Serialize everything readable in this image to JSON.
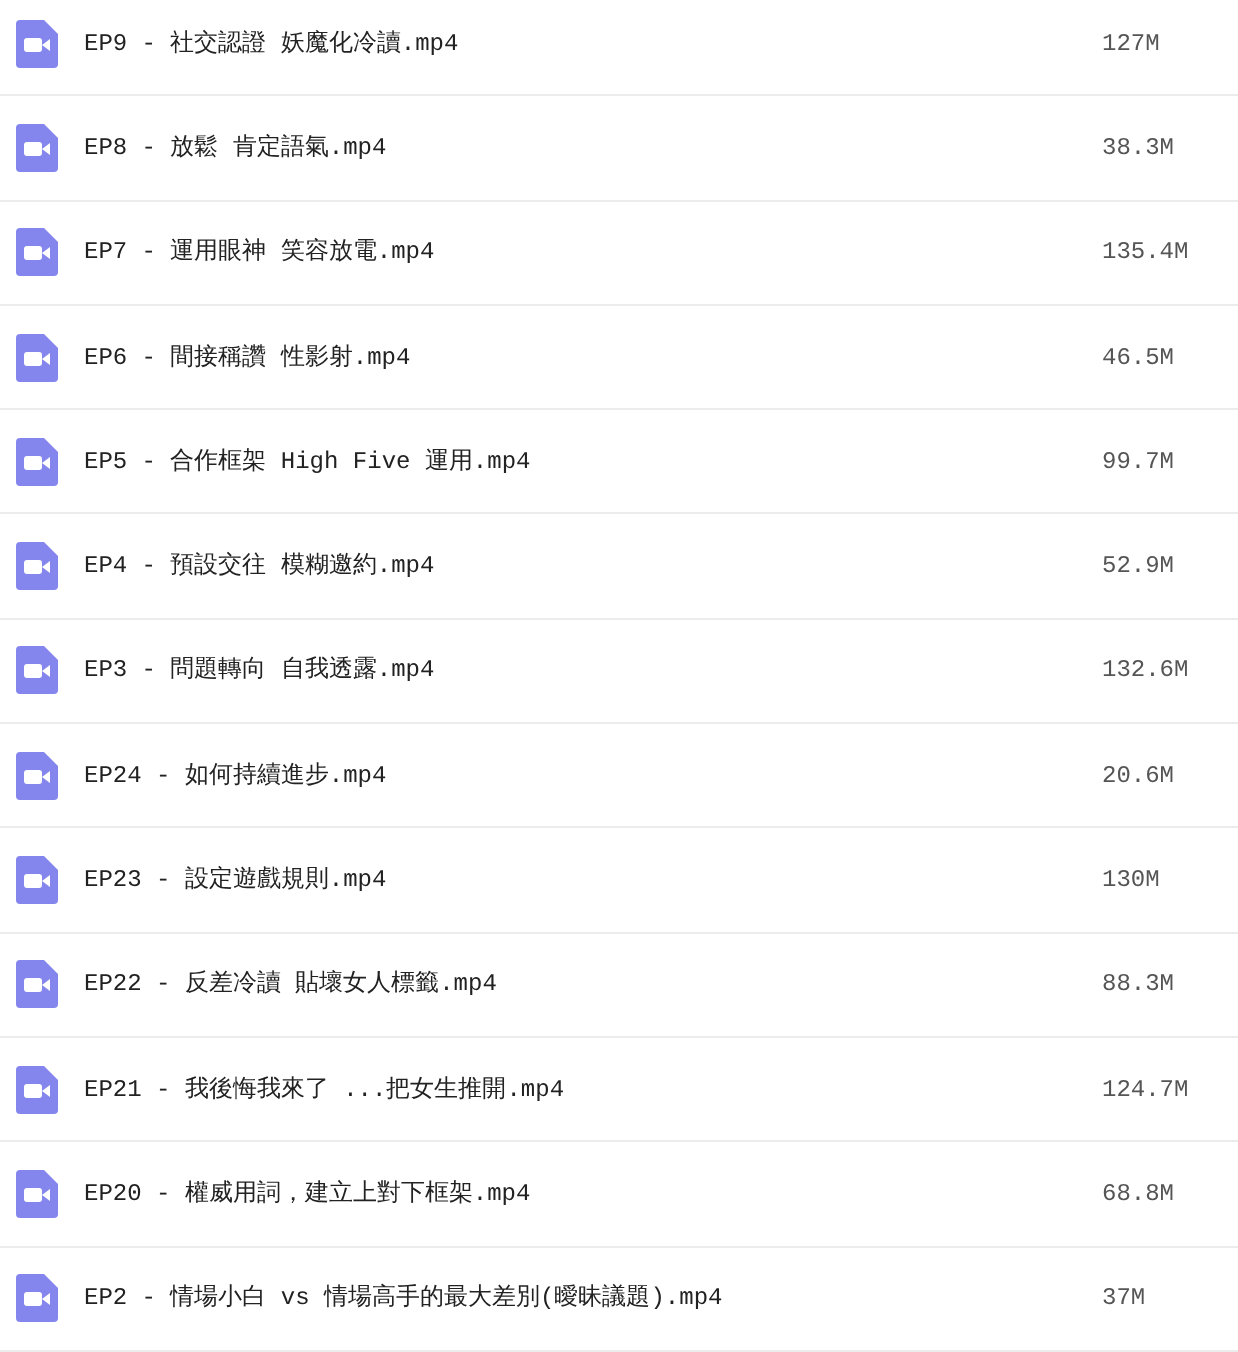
{
  "files": [
    {
      "name": "EP9 - 社交認證 妖魔化冷讀.mp4",
      "size": "127M"
    },
    {
      "name": "EP8 - 放鬆 肯定語氣.mp4",
      "size": "38.3M"
    },
    {
      "name": "EP7 - 運用眼神 笑容放電.mp4",
      "size": "135.4M"
    },
    {
      "name": "EP6 - 間接稱讚 性影射.mp4",
      "size": "46.5M"
    },
    {
      "name": "EP5 - 合作框架 High Five 運用.mp4",
      "size": "99.7M"
    },
    {
      "name": "EP4 - 預設交往 模糊邀約.mp4",
      "size": "52.9M"
    },
    {
      "name": "EP3 - 問題轉向 自我透露.mp4",
      "size": "132.6M"
    },
    {
      "name": "EP24 - 如何持續進步.mp4",
      "size": "20.6M"
    },
    {
      "name": "EP23 - 設定遊戲規則.mp4",
      "size": "130M"
    },
    {
      "name": "EP22 - 反差冷讀 貼壞女人標籤.mp4",
      "size": "88.3M"
    },
    {
      "name": "EP21 - 我後悔我來了 ...把女生推開.mp4",
      "size": "124.7M"
    },
    {
      "name": "EP20 - 權威用詞，建立上對下框架.mp4",
      "size": "68.8M"
    },
    {
      "name": "EP2 - 情場小白 vs 情場高手的最大差別(曖昧議題).mp4",
      "size": "37M"
    }
  ]
}
